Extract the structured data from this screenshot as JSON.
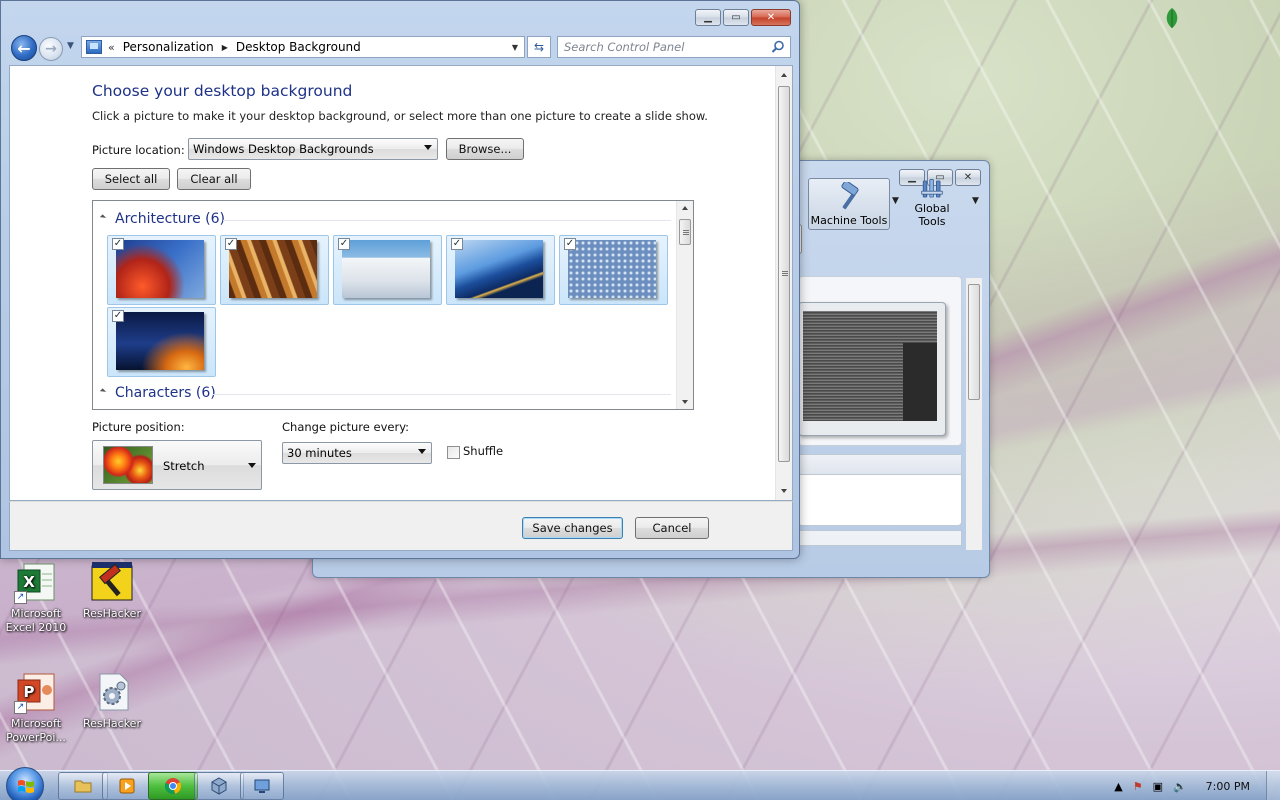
{
  "main_window": {
    "breadcrumb": {
      "root_chevron": "«",
      "items": [
        "Personalization",
        "Desktop Background"
      ]
    },
    "search_placeholder": "Search Control Panel",
    "heading": "Choose your desktop background",
    "instructions": "Click a picture to make it your desktop background, or select more than one picture to create a slide show.",
    "picture_location_label": "Picture location:",
    "picture_location_value": "Windows Desktop Backgrounds",
    "browse_label": "Browse...",
    "select_all_label": "Select all",
    "clear_all_label": "Clear all",
    "groups": [
      {
        "name": "Architecture (6)",
        "thumbs": [
          true,
          true,
          true,
          true,
          true,
          true
        ]
      },
      {
        "name": "Characters (6)"
      }
    ],
    "picture_position_label": "Picture position:",
    "picture_position_value": "Stretch",
    "change_every_label": "Change picture every:",
    "change_every_value": "30 minutes",
    "shuffle_label": "Shuffle",
    "shuffle_checked": false,
    "save_label": "Save changes",
    "cancel_label": "Cancel",
    "check_glyph": "✓"
  },
  "background_window": {
    "machine_tools_label": "Machine Tools",
    "global_tools_label": "Global Tools"
  },
  "desktop_icons": [
    {
      "label": "Microsoft Excel 2010"
    },
    {
      "label": "ResHacker"
    },
    {
      "label": "Microsoft PowerPoi..."
    },
    {
      "label": "ResHacker"
    }
  ],
  "taskbar": {
    "clock": "7:00 PM"
  },
  "colors": {
    "heading": "#1e3287",
    "window_frame": "#b9cde8",
    "close_button": "#c3412a"
  }
}
